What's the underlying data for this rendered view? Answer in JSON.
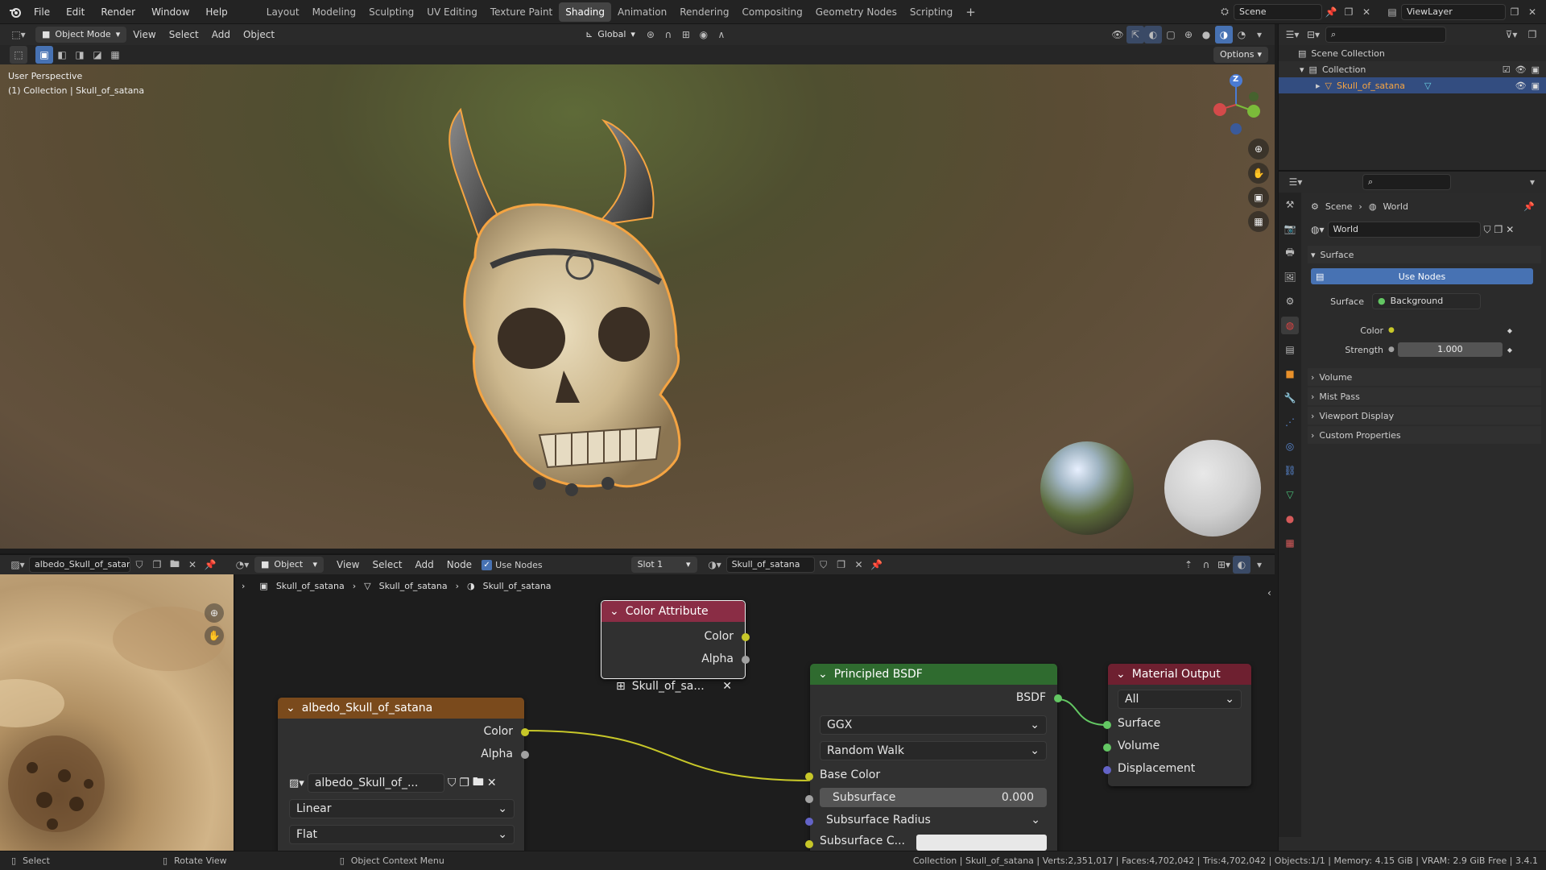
{
  "topbar": {
    "menus": [
      "File",
      "Edit",
      "Render",
      "Window",
      "Help"
    ],
    "workspaces": [
      "Layout",
      "Modeling",
      "Sculpting",
      "UV Editing",
      "Texture Paint",
      "Shading",
      "Animation",
      "Rendering",
      "Compositing",
      "Geometry Nodes",
      "Scripting"
    ],
    "active_workspace": "Shading",
    "add_tab": "+",
    "scene": "Scene",
    "view_layer": "ViewLayer"
  },
  "viewport": {
    "mode": "Object Mode",
    "menus": [
      "View",
      "Select",
      "Add",
      "Object"
    ],
    "transform_orientation": "Global",
    "options": "Options",
    "overlay_title": "User Perspective",
    "overlay_sub": "(1) Collection | Skull_of_satana",
    "gizmo_z": "Z"
  },
  "outliner": {
    "scene_collection": "Scene Collection",
    "collection": "Collection",
    "object": "Skull_of_satana"
  },
  "properties": {
    "breadcrumb_scene": "Scene",
    "breadcrumb_world": "World",
    "world_name": "World",
    "surface_panel": "Surface",
    "use_nodes": "Use Nodes",
    "surface_label": "Surface",
    "surface_value": "Background",
    "color_label": "Color",
    "strength_label": "Strength",
    "strength_value": "1.000",
    "panels": [
      "Volume",
      "Mist Pass",
      "Viewport Display",
      "Custom Properties"
    ]
  },
  "node_editor": {
    "image_name": "albedo_Skull_of_satana",
    "editor_type": "Object",
    "menus": [
      "View",
      "Select",
      "Add",
      "Node"
    ],
    "use_nodes": "Use Nodes",
    "slot": "Slot 1",
    "material": "Skull_of_satana",
    "breadcrumbs": [
      "Skull_of_satana",
      "Skull_of_satana",
      "Skull_of_satana"
    ],
    "nodes": {
      "color_attribute": {
        "title": "Color Attribute",
        "out_color": "Color",
        "out_alpha": "Alpha",
        "attr": "Skull_of_sa..."
      },
      "image_texture": {
        "title": "albedo_Skull_of_satana",
        "out_color": "Color",
        "out_alpha": "Alpha",
        "image": "albedo_Skull_of_...",
        "interpolation": "Linear",
        "projection": "Flat"
      },
      "principled": {
        "title": "Principled BSDF",
        "out": "BSDF",
        "distribution": "GGX",
        "sss_method": "Random Walk",
        "base_color": "Base Color",
        "subsurface": "Subsurface",
        "subsurface_value": "0.000",
        "subsurface_radius": "Subsurface Radius",
        "subsurface_color": "Subsurface C..."
      },
      "output": {
        "title": "Material Output",
        "target": "All",
        "surface": "Surface",
        "volume": "Volume",
        "displacement": "Displacement"
      }
    }
  },
  "statusbar": {
    "select": "Select",
    "rotate": "Rotate View",
    "context": "Object Context Menu",
    "stats": "Collection | Skull_of_satana | Verts:2,351,017 | Faces:4,702,042 | Tris:4,702,042 | Objects:1/1 | Memory: 4.15 GiB | VRAM: 2.9 GiB Free | 3.4.1"
  },
  "colors": {
    "accent": "#4772b3",
    "selection_outline": "#f5a442",
    "color_attr_header": "#8a2d45",
    "texture_header": "#7a4a1c",
    "shader_header": "#2f6b2f",
    "output_header": "#6e2030",
    "socket_yellow": "#c7c729",
    "socket_green": "#63c763",
    "socket_blue": "#6363c7",
    "socket_grey": "#a1a1a1"
  }
}
